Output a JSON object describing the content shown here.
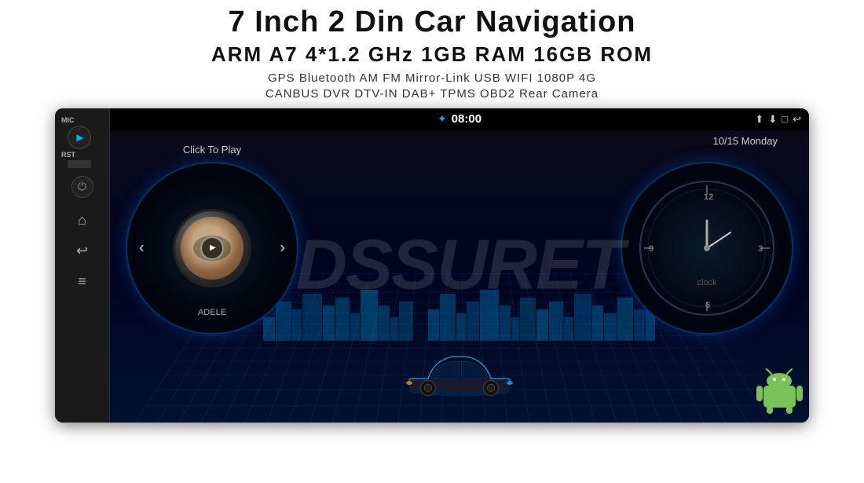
{
  "header": {
    "title": "7 Inch 2 Din Car Navigation",
    "specs": "ARM A7 4*1.2 GHz    1GB RAM    16GB ROM",
    "features_line1": "GPS  Bluetooth  AM  FM  Mirror-Link  USB  WIFI  1080P  4G",
    "features_line2": "CANBUS    DVR    DTV-IN    DAB+    TPMS    OBD2    Rear Camera"
  },
  "device": {
    "status_bar": {
      "time": "08:00",
      "icons": [
        "⬆",
        "⬇",
        "□",
        "↩"
      ]
    },
    "screen": {
      "click_to_play": "Click To Play",
      "date": "10/15 Monday",
      "artist": "ADELE",
      "clock_label": "clock"
    },
    "left_panel": {
      "mic_label": "MIC",
      "rst_label": "RST",
      "nav_icons": [
        "⌂",
        "↩",
        "≡"
      ]
    }
  },
  "watermark": "DSSURET",
  "colors": {
    "accent": "#00aaff",
    "bg": "#ffffff",
    "screen_bg": "#000520"
  }
}
